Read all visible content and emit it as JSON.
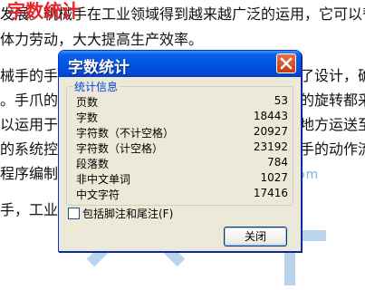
{
  "document": {
    "heading": "字数统计",
    "lines": [
      "发展。机械手在工业领域得到越来越广泛的运用，它可以替",
      "体力劳动，大大提高生产效率。",
      "械手的手爪",
      "。手爪的张",
      "以运用于工",
      "的系统控制",
      "程序编制。",
      "手，工业"
    ],
    "right_fragments": [
      "了设计，确",
      "的旋转都采",
      "地方运送至",
      "手的动作流"
    ],
    "watermark_url": "nrendoc.com"
  },
  "dialog": {
    "title": "字数统计",
    "group_label": "统计信息",
    "stats": [
      {
        "label": "页数",
        "value": "53"
      },
      {
        "label": "字数",
        "value": "18443"
      },
      {
        "label": "字符数（不计空格）",
        "value": "20927"
      },
      {
        "label": "字符数（计空格）",
        "value": "23192"
      },
      {
        "label": "段落数",
        "value": "784"
      },
      {
        "label": "非中文单词",
        "value": "1027"
      },
      {
        "label": "中文字符",
        "value": "17416"
      }
    ],
    "checkbox_label": "包括脚注和尾注(F)",
    "checkbox_checked": false,
    "close_button_label": "关闭"
  }
}
